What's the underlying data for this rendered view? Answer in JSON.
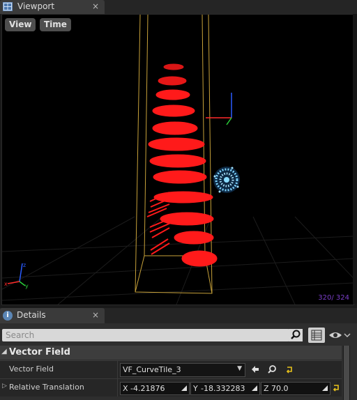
{
  "viewport_tab": {
    "title": "Viewport",
    "close": "×"
  },
  "viewport": {
    "view_button": "View",
    "time_button": "Time",
    "frame_counter": "320/ 324"
  },
  "details_tab": {
    "title": "Details",
    "close": "×",
    "icon_letter": "i"
  },
  "details": {
    "search_placeholder": "Search",
    "section_title": "Vector Field",
    "rows": [
      {
        "label": "Vector Field",
        "value": "VF_CurveTile_3"
      },
      {
        "label": "Relative Translation",
        "x_axis": "X",
        "x": "-4.21876",
        "y_axis": "Y",
        "y": "-18.332283",
        "z_axis": "Z",
        "z": "70.0"
      }
    ]
  },
  "colors": {
    "bounds_box": "#c8a23a",
    "vector_arrows": "#ff1a1a",
    "particle_sphere": "#7fd4ff",
    "frame_counter": "#7a3ec8"
  },
  "icons": [
    "viewport-tab-icon",
    "close-icon",
    "details-info-icon",
    "search-icon",
    "grid-view-icon",
    "eye-icon",
    "arrow-left-icon",
    "browse-icon",
    "reset-icon",
    "expand-arrow-icon"
  ]
}
